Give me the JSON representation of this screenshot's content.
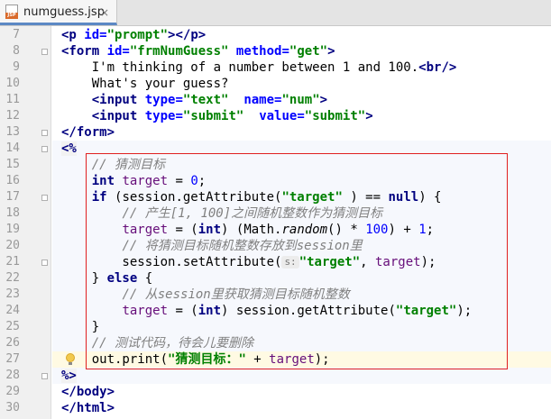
{
  "tab": {
    "filename": "numguess.jsp",
    "close_glyph": "×",
    "icon_text": "JSP"
  },
  "line_numbers": [
    "7",
    "8",
    "9",
    "10",
    "11",
    "12",
    "13",
    "14",
    "15",
    "16",
    "17",
    "18",
    "19",
    "20",
    "21",
    "22",
    "23",
    "24",
    "25",
    "26",
    "27",
    "28",
    "29",
    "30"
  ],
  "code_lines": [
    [
      [
        "tag",
        "<p "
      ],
      [
        "attr",
        "id="
      ],
      [
        "str",
        "\"prompt\""
      ],
      [
        "tag",
        "></p>"
      ]
    ],
    [
      [
        "tag",
        "<form "
      ],
      [
        "attr",
        "id="
      ],
      [
        "str",
        "\"frmNumGuess\""
      ],
      [
        "tag",
        " "
      ],
      [
        "attr",
        "method="
      ],
      [
        "str",
        "\"get\""
      ],
      [
        "tag",
        ">"
      ]
    ],
    [
      [
        "",
        "    I'm thinking of a number between 1 and 100."
      ],
      [
        "tag",
        "<br/>"
      ]
    ],
    [
      [
        "",
        "    What's your guess?"
      ]
    ],
    [
      [
        "",
        "    "
      ],
      [
        "tag",
        "<input "
      ],
      [
        "attr",
        "type="
      ],
      [
        "str",
        "\"text\""
      ],
      [
        "",
        "  "
      ],
      [
        "attr",
        "name="
      ],
      [
        "str",
        "\"num\""
      ],
      [
        "tag",
        ">"
      ]
    ],
    [
      [
        "",
        "    "
      ],
      [
        "tag",
        "<input "
      ],
      [
        "attr",
        "type="
      ],
      [
        "str",
        "\"submit\""
      ],
      [
        "",
        "  "
      ],
      [
        "attr",
        "value="
      ],
      [
        "str",
        "\"submit\""
      ],
      [
        "tag",
        ">"
      ]
    ],
    [
      [
        "tag",
        "</form>"
      ]
    ],
    [
      [
        "tag dir",
        "<%"
      ]
    ],
    [
      [
        "",
        "    "
      ],
      [
        "com",
        "// 猜测目标"
      ]
    ],
    [
      [
        "",
        "    "
      ],
      [
        "kw",
        "int "
      ],
      [
        "fld",
        "target"
      ],
      [
        "",
        " = "
      ],
      [
        "num",
        "0"
      ],
      [
        "",
        ";"
      ]
    ],
    [
      [
        "",
        "    "
      ],
      [
        "kw",
        "if "
      ],
      [
        "",
        "(session.getAttribute("
      ],
      [
        "str",
        "\"target\""
      ],
      [
        "",
        " ) == "
      ],
      [
        "kw",
        "null"
      ],
      [
        "",
        ") {"
      ]
    ],
    [
      [
        "",
        "        "
      ],
      [
        "com",
        "// 产生[1, 100]之间随机整数作为猜测目标"
      ]
    ],
    [
      [
        "",
        "        "
      ],
      [
        "fld",
        "target"
      ],
      [
        "",
        " = ("
      ],
      [
        "kw",
        "int"
      ],
      [
        "",
        ") (Math."
      ],
      [
        "itl",
        "random"
      ],
      [
        "",
        "() * "
      ],
      [
        "num",
        "100"
      ],
      [
        "",
        ") + "
      ],
      [
        "num",
        "1"
      ],
      [
        "",
        ";"
      ]
    ],
    [
      [
        "",
        "        "
      ],
      [
        "com",
        "// 将猜测目标随机整数存放到session里"
      ]
    ],
    [
      [
        "",
        "        session.setAttribute("
      ],
      [
        "hint",
        "s:"
      ],
      [
        "str",
        "\"target\""
      ],
      [
        "",
        ", "
      ],
      [
        "fld",
        "target"
      ],
      [
        "",
        ");"
      ]
    ],
    [
      [
        "",
        "    } "
      ],
      [
        "kw",
        "else "
      ],
      [
        "",
        "{"
      ]
    ],
    [
      [
        "",
        "        "
      ],
      [
        "com",
        "// 从session里获取猜测目标随机整数"
      ]
    ],
    [
      [
        "",
        "        "
      ],
      [
        "fld",
        "target"
      ],
      [
        "",
        " = ("
      ],
      [
        "kw",
        "int"
      ],
      [
        "",
        ") session.getAttribute("
      ],
      [
        "str",
        "\"target\""
      ],
      [
        "",
        ");"
      ]
    ],
    [
      [
        "",
        "    }"
      ]
    ],
    [
      [
        "",
        "    "
      ],
      [
        "com",
        "// 测试代码，待会儿要删除"
      ]
    ],
    [
      [
        "",
        "    out.print("
      ],
      [
        "str",
        "\"猜测目标：\""
      ],
      [
        "",
        " + "
      ],
      [
        "fld",
        "target"
      ],
      [
        "",
        ");"
      ]
    ],
    [
      [
        "tag dir",
        "%>"
      ]
    ],
    [
      [
        "tag",
        "</body>"
      ]
    ],
    [
      [
        "tag",
        "</html>"
      ]
    ]
  ],
  "java_lines": [
    7,
    8,
    9,
    10,
    11,
    12,
    13,
    14,
    15,
    16,
    17,
    18,
    19,
    20,
    21
  ],
  "current_line": 20,
  "colors": {
    "tag": "#000080",
    "attribute": "#0000ff",
    "string": "#008000",
    "keyword": "#000080",
    "number": "#0000ff",
    "comment": "#808080",
    "field": "#660e7a",
    "highlight_box": "#e02020",
    "current_line_bg": "#fffae3",
    "java_block_bg": "#f6f8fd"
  },
  "icons": [
    "jsp-file-icon",
    "close-icon",
    "fold-marker-icon",
    "lightbulb-intention-icon"
  ]
}
